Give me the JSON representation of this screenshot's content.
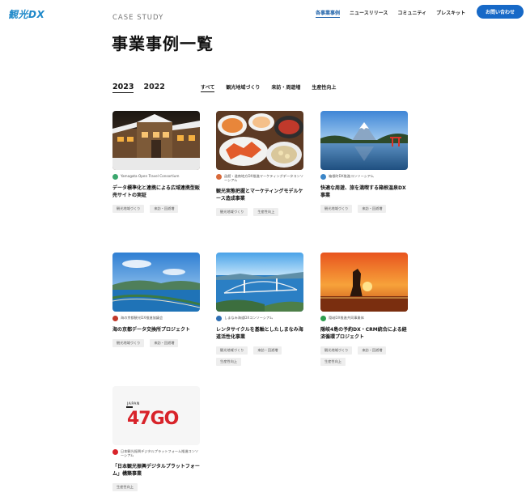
{
  "brand": {
    "logo_main": "観光",
    "logo_accent": "DX"
  },
  "nav": {
    "items": [
      "各事業事例",
      "ニュースリリース",
      "コミュニティ",
      "プレスキット"
    ],
    "contact": "お問い合わせ"
  },
  "header": {
    "eyebrow": "CASE STUDY",
    "title": "事業事例一覧"
  },
  "filters": {
    "years": [
      "2023",
      "2022"
    ],
    "categories": [
      "すべて",
      "観光地域づくり",
      "来訪・周遊増",
      "生産性向上"
    ]
  },
  "cards": [
    {
      "org": "Yamagata Open Travel Consortium",
      "title": "データ標準化と連携による広域連携型販売サイトの実証",
      "tags": [
        "観光地域づくり",
        "来訪・回遊増"
      ]
    },
    {
      "org": "函館・道南地方DX推進マーケティングデータコンソーシアム",
      "title": "観光実態把握とマーケティングモデルケース造成事業",
      "tags": [
        "観光地域づくり",
        "生産性向上"
      ]
    },
    {
      "org": "箱根町DX推進コンソーシアム",
      "title": "快適な周遊、旅を満喫する箱根温泉DX事業",
      "tags": [
        "観光地域づくり",
        "来訪・回遊増"
      ]
    },
    {
      "org": "海の京都観光DX推進協議会",
      "title": "海の京都データ交換所プロジェクト",
      "tags": [
        "観光地域づくり",
        "来訪・回遊増"
      ]
    },
    {
      "org": "しまなみ海道DXコンソーシアム",
      "title": "レンタサイクルを基軸としたしまなみ海道活性化事業",
      "tags": [
        "観光地域づくり",
        "来訪・回遊増",
        "生産性向上"
      ]
    },
    {
      "org": "隠岐DX推進共同事業体",
      "title": "隠岐4島の予約DX・CRM統合による経済循環プロジェクト",
      "tags": [
        "観光地域づくり",
        "来訪・回遊増",
        "生産性向上"
      ]
    },
    {
      "org": "日本観光振興デジタルプラットフォーム推進コンソーシアム",
      "title": "「日本観光振興デジタルプラットフォーム」構築事業",
      "tags": [
        "生産性向上"
      ]
    }
  ],
  "logo_image": {
    "small_text": "JAPAN",
    "main_text": "47GO"
  },
  "colors": {
    "accent": "#1769c7",
    "logo_red": "#d8232a",
    "logo_teal": "#2bb3a6"
  }
}
